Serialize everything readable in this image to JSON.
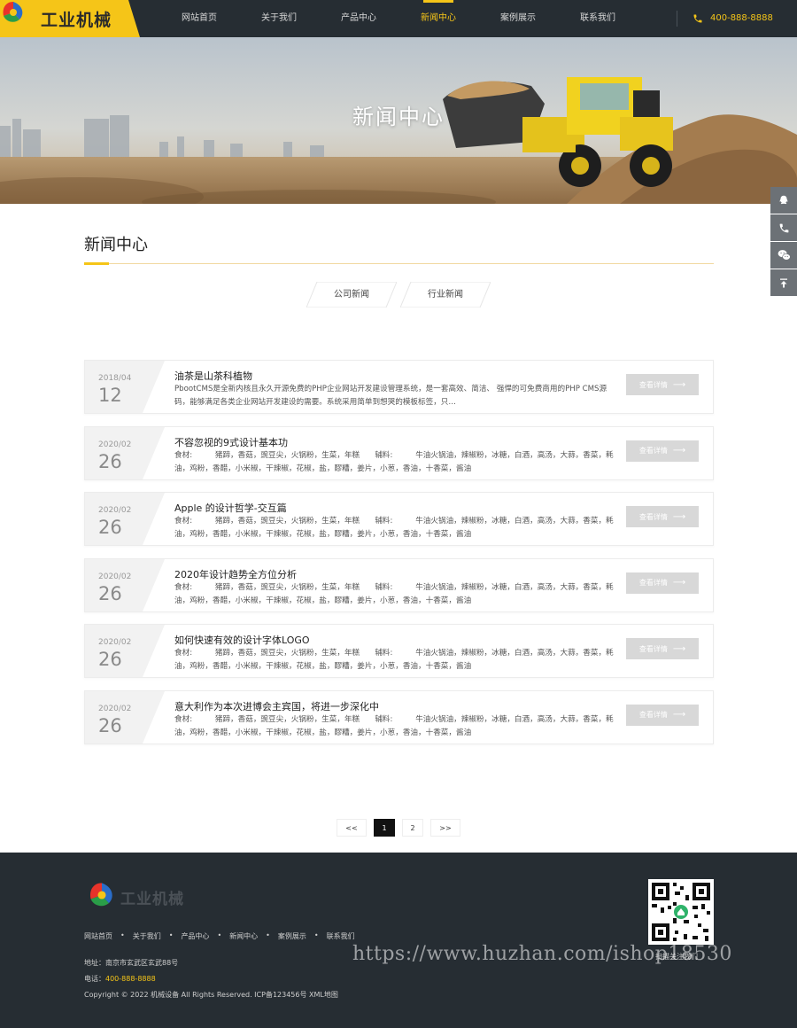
{
  "header": {
    "logo_text": "工业机械",
    "nav": [
      {
        "label": "网站首页",
        "active": false
      },
      {
        "label": "关于我们",
        "active": false
      },
      {
        "label": "产品中心",
        "active": false
      },
      {
        "label": "新闻中心",
        "active": true
      },
      {
        "label": "案例展示",
        "active": false
      },
      {
        "label": "联系我们",
        "active": false
      }
    ],
    "phone": "400-888-8888"
  },
  "banner": {
    "title": "新闻中心"
  },
  "section": {
    "title": "新闻中心"
  },
  "tabs": [
    {
      "label": "公司新闻"
    },
    {
      "label": "行业新闻"
    }
  ],
  "news": [
    {
      "ym": "2018/04",
      "day": "12",
      "title": "油茶是山茶科植物",
      "desc": "PbootCMS是全新内核且永久开源免费的PHP企业网站开发建设管理系统，是一套高效、简洁、 强悍的可免费商用的PHP CMS源码，能够满足各类企业网站开发建设的需要。系统采用简单到想哭的模板标签，只…",
      "button": "查看详情"
    },
    {
      "ym": "2020/02",
      "day": "26",
      "title": "不容忽视的9式设计基本功",
      "desc": "食材:　　　猪蹄，香菇，豌豆尖，火锅粉，生菜，年糕　　辅料:　　　牛油火锅油，辣椒粉，冰糖，白酒，高汤，大蒜，香菜，耗油，鸡粉，香醋，小米椒，干辣椒，花椒，盐，醪糟，姜片，小葱，香油，十香菜，酱油",
      "button": "查看详情"
    },
    {
      "ym": "2020/02",
      "day": "26",
      "title": "Apple 的设计哲学-交互篇",
      "desc": "食材:　　　猪蹄，香菇，豌豆尖，火锅粉，生菜，年糕　　辅料:　　　牛油火锅油，辣椒粉，冰糖，白酒，高汤，大蒜，香菜，耗油，鸡粉，香醋，小米椒，干辣椒，花椒，盐，醪糟，姜片，小葱，香油，十香菜，酱油",
      "button": "查看详情"
    },
    {
      "ym": "2020/02",
      "day": "26",
      "title": "2020年设计趋势全方位分析",
      "desc": "食材:　　　猪蹄，香菇，豌豆尖，火锅粉，生菜，年糕　　辅料:　　　牛油火锅油，辣椒粉，冰糖，白酒，高汤，大蒜，香菜，耗油，鸡粉，香醋，小米椒，干辣椒，花椒，盐，醪糟，姜片，小葱，香油，十香菜，酱油",
      "button": "查看详情"
    },
    {
      "ym": "2020/02",
      "day": "26",
      "title": "如何快速有效的设计字体LOGO",
      "desc": "食材:　　　猪蹄，香菇，豌豆尖，火锅粉，生菜，年糕　　辅料:　　　牛油火锅油，辣椒粉，冰糖，白酒，高汤，大蒜，香菜，耗油，鸡粉，香醋，小米椒，干辣椒，花椒，盐，醪糟，姜片，小葱，香油，十香菜，酱油",
      "button": "查看详情"
    },
    {
      "ym": "2020/02",
      "day": "26",
      "title": "意大利作为本次进博会主宾国，将进一步深化中",
      "desc": "食材:　　　猪蹄，香菇，豌豆尖，火锅粉，生菜，年糕　　辅料:　　　牛油火锅油，辣椒粉，冰糖，白酒，高汤，大蒜，香菜，耗油，鸡粉，香醋，小米椒，干辣椒，花椒，盐，醪糟，姜片，小葱，香油，十香菜，酱油",
      "button": "查看详情"
    }
  ],
  "pagination": {
    "prev": "<<",
    "pages": [
      "1",
      "2"
    ],
    "current": "1",
    "next": ">>"
  },
  "footer": {
    "logo_text": "工业机械",
    "nav": [
      "网站首页",
      "关于我们",
      "产品中心",
      "新闻中心",
      "案例展示",
      "联系我们"
    ],
    "address": "地址：南京市玄武区玄武88号",
    "tel_label": "电话：",
    "tel": "400-888-8888",
    "copyright": "Copyright © 2022 机械设备 All Rights Reserved. ICP备123456号 XML地图",
    "qr_caption": "扫描关注我们"
  },
  "watermark": "https://www.huzhan.com/ishop18530",
  "colors": {
    "accent": "#f5c518",
    "header_bg": "#262d33",
    "button_gray": "#d8d8d8"
  },
  "icons": [
    "phone-icon",
    "qq-icon",
    "wechat-icon",
    "back-to-top-icon",
    "arrow-right-icon",
    "logo-icon",
    "qr-code-icon"
  ]
}
